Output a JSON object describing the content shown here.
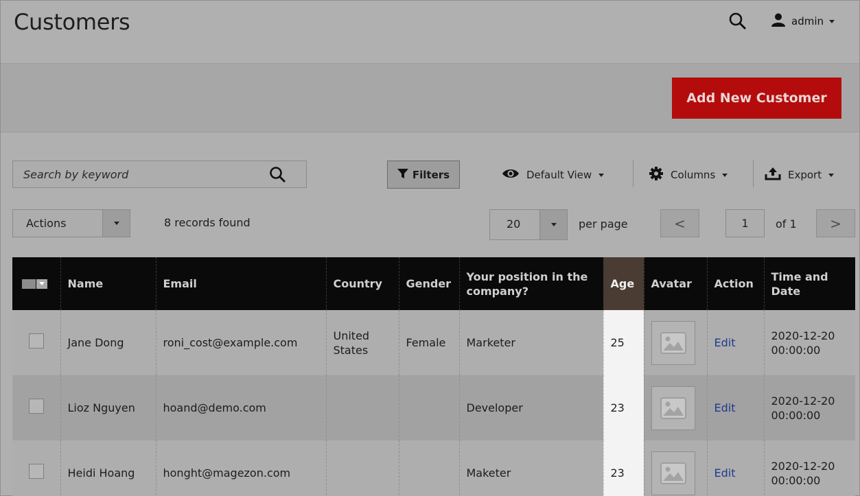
{
  "page": {
    "title": "Customers"
  },
  "header": {
    "user_name": "admin"
  },
  "action_bar": {
    "add_button_label": "Add New Customer"
  },
  "toolbar": {
    "search_placeholder": "Search by keyword",
    "filters_label": "Filters",
    "view_label": "Default View",
    "columns_label": "Columns",
    "export_label": "Export"
  },
  "mass_actions": {
    "label": "Actions",
    "records_found": "8 records found"
  },
  "pagination": {
    "per_page_value": "20",
    "per_page_label": "per page",
    "current_page": "1",
    "total_pages_label": "of 1",
    "prev_symbol": "<",
    "next_symbol": ">"
  },
  "table": {
    "columns": [
      "",
      "Name",
      "Email",
      "Country",
      "Gender",
      "Your position in the company?",
      "Age",
      "Avatar",
      "Action",
      "Time and Date"
    ],
    "rows": [
      {
        "name": "Jane Dong",
        "email": "roni_cost@example.com",
        "country": "United States",
        "gender": "Female",
        "position": "Marketer",
        "age": "25",
        "action": "Edit",
        "datetime": "2020-12-20 00:00:00"
      },
      {
        "name": "Lioz Nguyen",
        "email": "hoand@demo.com",
        "country": "",
        "gender": "",
        "position": "Developer",
        "age": "23",
        "action": "Edit",
        "datetime": "2020-12-20 00:00:00"
      },
      {
        "name": "Heidi Hoang",
        "email": "honght@magezon.com",
        "country": "",
        "gender": "",
        "position": "Maketer",
        "age": "23",
        "action": "Edit",
        "datetime": "2020-12-20 00:00:00"
      }
    ]
  },
  "colors": {
    "accent_button": "#b40c0c",
    "header_bg": "#0a0a0a",
    "highlight_column": "#f3f3f3",
    "link": "#203a8a"
  },
  "icons": [
    "search-icon",
    "user-icon",
    "filter-icon",
    "eye-icon",
    "gear-icon",
    "export-icon",
    "image-placeholder-icon"
  ]
}
